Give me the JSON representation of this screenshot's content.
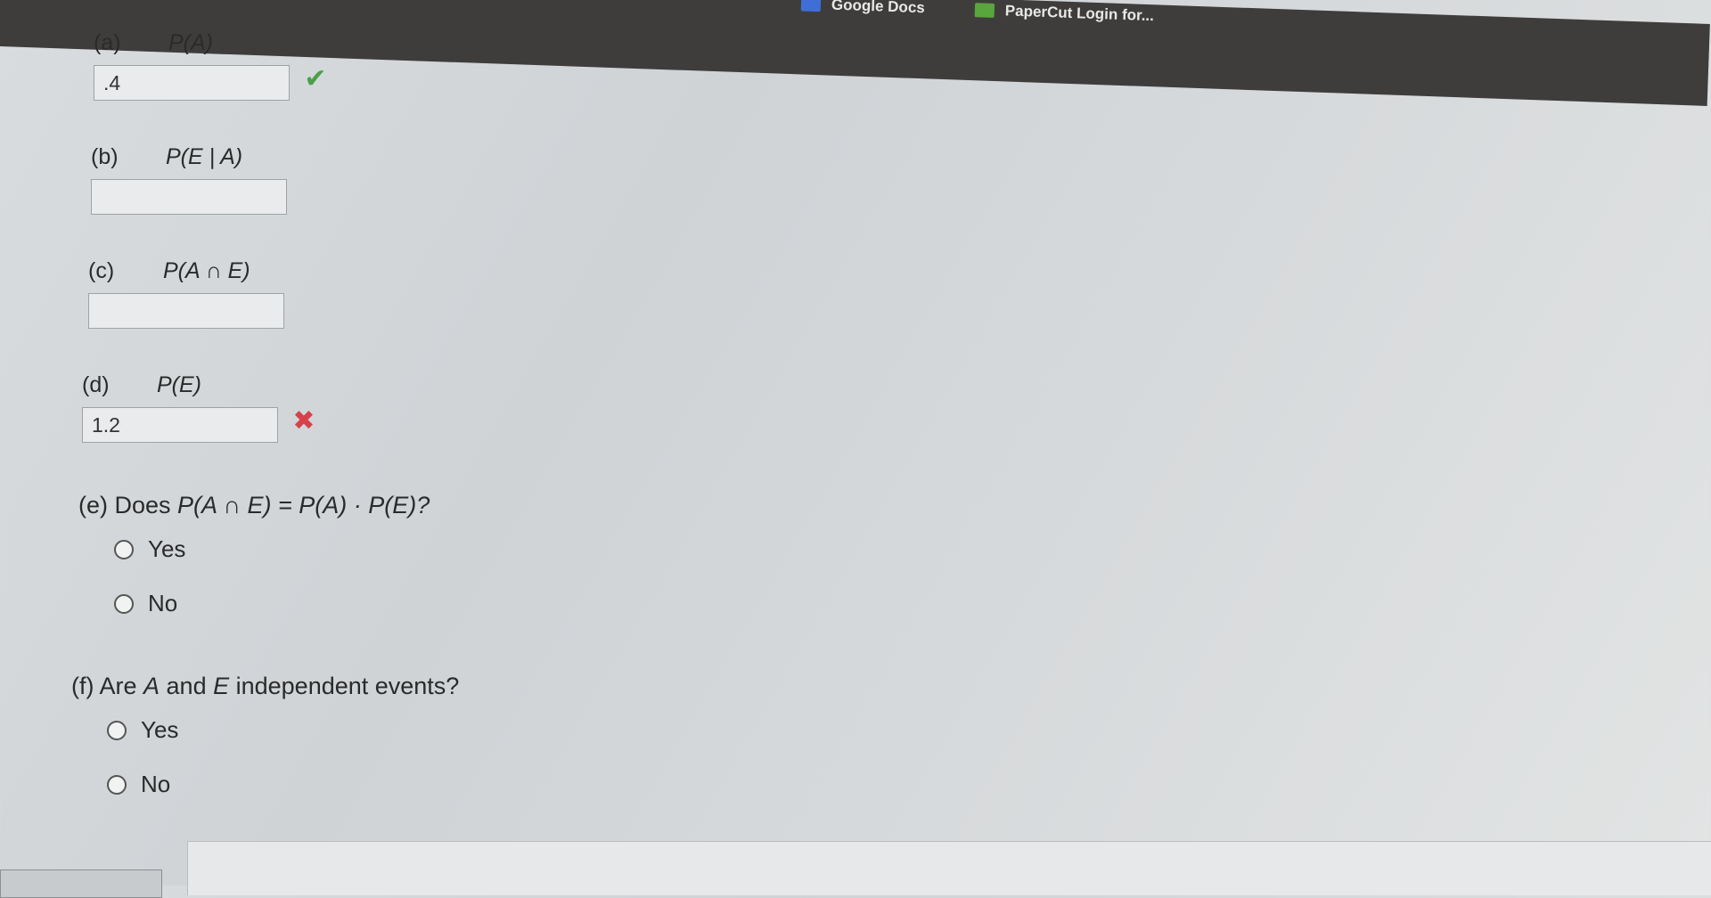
{
  "bookmarks": {
    "google_docs": "Google Docs",
    "papercut": "PaperCut Login for..."
  },
  "parts": {
    "a": {
      "letter": "(a)",
      "expr": "P(A)",
      "value": ".4",
      "status": "correct"
    },
    "b": {
      "letter": "(b)",
      "expr": "P(E | A)",
      "value": ""
    },
    "c": {
      "letter": "(c)",
      "expr": "P(A ∩ E)",
      "value": ""
    },
    "d": {
      "letter": "(d)",
      "expr": "P(E)",
      "value": "1.2",
      "status": "wrong"
    }
  },
  "question_e": {
    "prefix": "(e) Does ",
    "expr": "P(A ∩ E) = P(A) · P(E)?",
    "options": [
      "Yes",
      "No"
    ]
  },
  "question_f": {
    "text_before": "(f) Are ",
    "var_a": "A",
    "text_mid": " and ",
    "var_e": "E",
    "text_after": " independent events?",
    "options": [
      "Yes",
      "No"
    ]
  },
  "icons": {
    "correct": "checkmark-icon",
    "wrong": "x-mark-icon"
  },
  "colors": {
    "correct": "#4aa04a",
    "wrong": "#d6414b"
  }
}
